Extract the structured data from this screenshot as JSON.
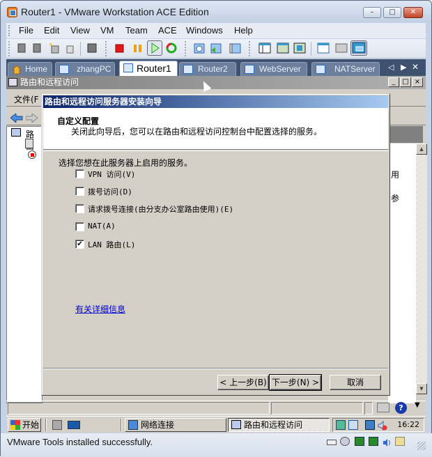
{
  "window": {
    "title": "Router1 - VMware Workstation ACE Edition",
    "minimize": "–",
    "restore": "□",
    "close": "✕"
  },
  "menubar": [
    "File",
    "Edit",
    "View",
    "VM",
    "Team",
    "ACE",
    "Windows",
    "Help"
  ],
  "toolbar_icons": [
    "snapshot-icon",
    "revert-icon",
    "new-vm-icon",
    "usb-icon",
    "screenshot-icon",
    "stop-icon",
    "pause-icon",
    "play-icon",
    "reset-icon",
    "take-snapshot-icon",
    "revert-snapshot-icon",
    "snapshot-manager-icon",
    "sidebar-icon",
    "fullscreen-icon",
    "quick-switch-icon",
    "settings-icon",
    "console-icon",
    "unity-icon"
  ],
  "tabs": [
    {
      "label": "Home",
      "icon": "home-icon",
      "active": false
    },
    {
      "label": "zhangPC",
      "icon": "vm-icon",
      "active": false
    },
    {
      "label": "Router1",
      "icon": "vm-running-icon",
      "active": true
    },
    {
      "label": "Router2",
      "icon": "vm-running-icon",
      "active": false
    },
    {
      "label": "WebServer",
      "icon": "vm-icon",
      "active": false
    },
    {
      "label": "NATServer",
      "icon": "vm-running-icon",
      "active": false
    }
  ],
  "tab_nav": {
    "prev": "◁",
    "next": "▶",
    "close": "✕"
  },
  "mmc": {
    "title": "路由和远程访问",
    "menu_file": "文件(F",
    "tree_root": "路由",
    "right_text_1": "用",
    "right_text_2": "参"
  },
  "dialog": {
    "title": "路由和远程访问服务器安装向导",
    "heading": "自定义配置",
    "subheading": "关闭此向导后，您可以在路由和远程访问控制台中配置选择的服务。",
    "intro": "选择您想在此服务器上启用的服务。",
    "options": [
      {
        "label": "VPN 访问(V)",
        "checked": false
      },
      {
        "label": "拨号访问(D)",
        "checked": false
      },
      {
        "label": "请求拨号连接(由分支办公室路由使用)(E)",
        "checked": false
      },
      {
        "label": "NAT(A)",
        "checked": false
      },
      {
        "label": "LAN 路由(L)",
        "checked": true
      }
    ],
    "check_mark": "✔",
    "link": "有关详细信息",
    "back_button": "< 上一步(B)",
    "next_button": "下一步(N) >",
    "cancel_button": "取消"
  },
  "taskbar": {
    "start": "开始",
    "items": [
      {
        "label": "网络连接",
        "pressed": false
      },
      {
        "label": "路由和远程访问",
        "pressed": true
      }
    ],
    "clock": "16:22"
  },
  "status": {
    "message": "VMware Tools installed successfully."
  }
}
